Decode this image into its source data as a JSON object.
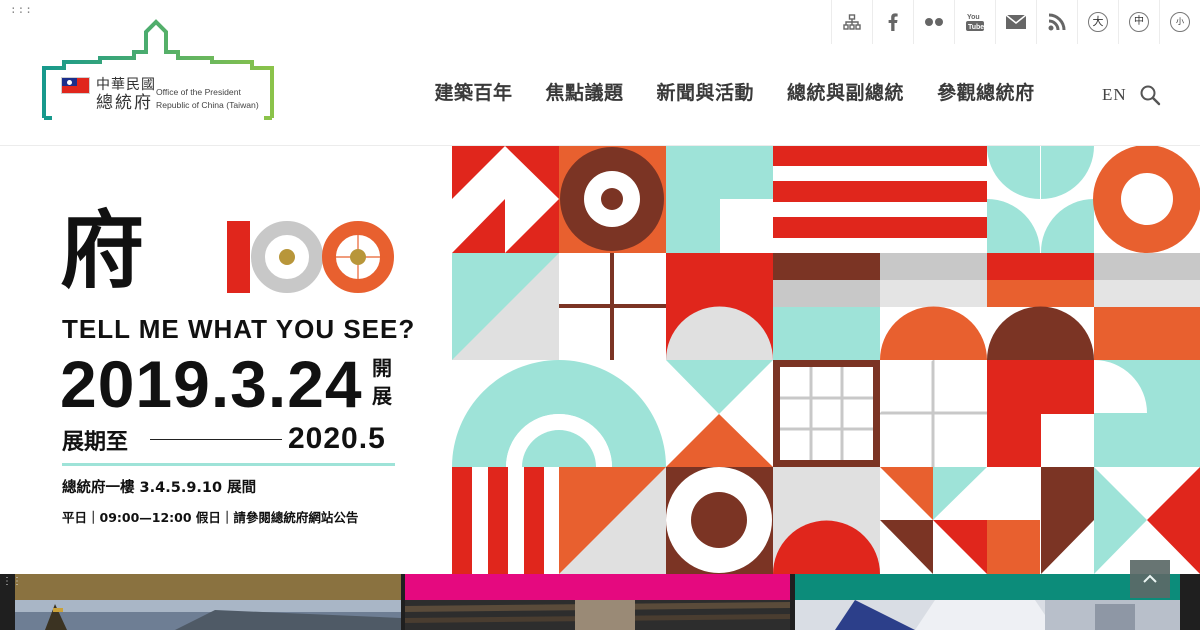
{
  "header": {
    "accesskey": ":::",
    "logo": {
      "zh_line1": "中華民國",
      "zh_line2": "總統府",
      "en_line1": "Office of the President",
      "en_line2": "Republic of China (Taiwan)"
    },
    "utility_icons": [
      "sitemap-icon",
      "facebook-icon",
      "flickr-icon",
      "youtube-icon",
      "mail-icon",
      "rss-icon"
    ],
    "font_sizes": {
      "large": "大",
      "medium": "中",
      "small": "小"
    },
    "nav": [
      "建築百年",
      "焦點議題",
      "新聞與活動",
      "總統與副總統",
      "參觀總統府"
    ],
    "lang": "EN"
  },
  "hero": {
    "title_char": "府",
    "tagline": "TELL ME WHAT YOU SEE?",
    "open_date": "2019.3.24",
    "open_label": "開展",
    "until_label": "展期至",
    "end_date": "2020.5",
    "location": "總統府一樓  3.4.5.9.10 展間",
    "hours": "平日｜09:00—12:00   假日｜請參閱總統府網站公告"
  },
  "cards": {
    "handle": "⋮⋮",
    "items": [
      {
        "color": "#8a7240"
      },
      {
        "color": "#e5097f"
      },
      {
        "color": "#0c8c7a"
      }
    ]
  },
  "colors": {
    "red": "#e0261c",
    "orange": "#e8602f",
    "brown": "#7b3424",
    "mint": "#9ee3d8",
    "grey": "#c8c8c8",
    "logo_green": "#5ab05a",
    "logo_teal": "#1a9b8c"
  }
}
